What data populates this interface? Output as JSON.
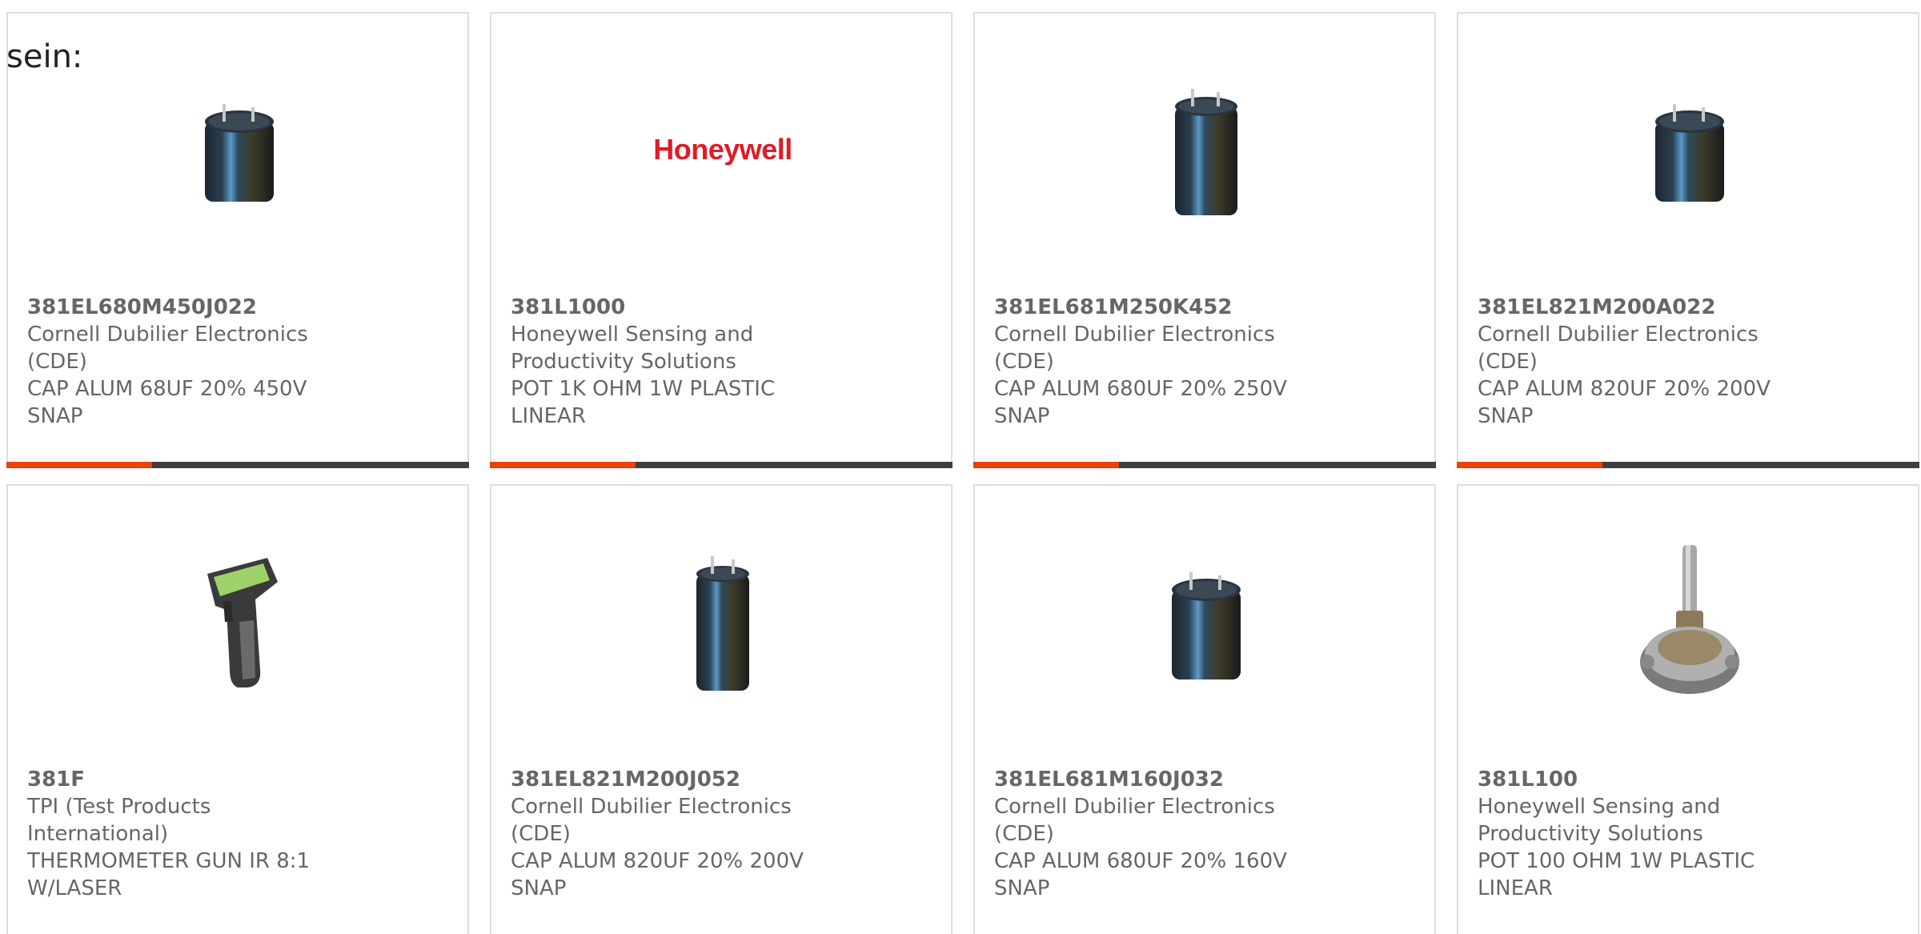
{
  "intro_text": "sein:",
  "colors": {
    "accent": "#e8420d",
    "bar_track": "#3f3f3f",
    "border": "#dedede",
    "text": "#666666",
    "honeywell_red": "#e11a27"
  },
  "cards": [
    {
      "image": "capacitor-icon",
      "part_number": "381EL680M450J022",
      "manufacturer": "Cornell Dubilier Electronics (CDE)",
      "description": "CAP ALUM 68UF 20% 450V SNAP",
      "progress_fraction": 0.315
    },
    {
      "image": "honeywell-logo",
      "logo_text": "Honeywell",
      "part_number": "381L1000",
      "manufacturer": "Honeywell Sensing and Productivity Solutions",
      "description": "POT 1K OHM 1W PLASTIC LINEAR",
      "progress_fraction": 0.315
    },
    {
      "image": "capacitor-tall-icon",
      "part_number": "381EL681M250K452",
      "manufacturer": "Cornell Dubilier Electronics (CDE)",
      "description": "CAP ALUM 680UF 20% 250V SNAP",
      "progress_fraction": 0.315
    },
    {
      "image": "capacitor-icon",
      "part_number": "381EL821M200A022",
      "manufacturer": "Cornell Dubilier Electronics (CDE)",
      "description": "CAP ALUM 820UF 20% 200V SNAP",
      "progress_fraction": 0.315
    },
    {
      "image": "thermometer-gun-icon",
      "part_number": "381F",
      "manufacturer": "TPI (Test Products International)",
      "description": "THERMOMETER GUN IR 8:1 W/LASER"
    },
    {
      "image": "capacitor-tall-icon",
      "part_number": "381EL821M200J052",
      "manufacturer": "Cornell Dubilier Electronics (CDE)",
      "description": "CAP ALUM 820UF 20% 200V SNAP"
    },
    {
      "image": "capacitor-icon",
      "part_number": "381EL681M160J032",
      "manufacturer": "Cornell Dubilier Electronics (CDE)",
      "description": "CAP ALUM 680UF 20% 160V SNAP"
    },
    {
      "image": "potentiometer-icon",
      "part_number": "381L100",
      "manufacturer": "Honeywell Sensing and Productivity Solutions",
      "description": "POT 100 OHM 1W PLASTIC LINEAR"
    }
  ]
}
